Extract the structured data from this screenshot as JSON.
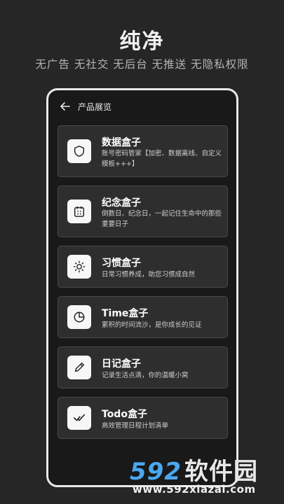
{
  "header": {
    "title": "纯净",
    "tagline": "无广告 无社交 无后台 无推送 无隐私权限"
  },
  "app": {
    "title": "产品展览",
    "back_icon": "arrow-left-icon"
  },
  "cards": [
    {
      "title": "数据盒子",
      "desc": "账号密码管家【加密、数据离线、自定义模板+++】",
      "icon": "shield-icon"
    },
    {
      "title": "纪念盒子",
      "desc": "倒数日、纪念日，一起记住生命中的那些重要日子",
      "icon": "calendar-icon"
    },
    {
      "title": "习惯盒子",
      "desc": "日常习惯养成，助您习惯成自然",
      "icon": "sun-icon"
    },
    {
      "title": "Time盒子",
      "desc": "累积的时间流沙，是你成长的见证",
      "icon": "pie-chart-icon"
    },
    {
      "title": "日记盒子",
      "desc": "记录生活点滴，你的温暖小窝",
      "icon": "pencil-icon"
    },
    {
      "title": "Todo盒子",
      "desc": "高效管理日程计划清单",
      "icon": "double-check-icon"
    }
  ],
  "watermark": {
    "logo_number": "592",
    "logo_text": "软件园",
    "url": "www.592xiazai.com"
  },
  "colors": {
    "background": "#262626",
    "phone_bg": "#191919",
    "card_bg": "#2e2e2e",
    "watermark_blue": "#4aa8f0"
  }
}
